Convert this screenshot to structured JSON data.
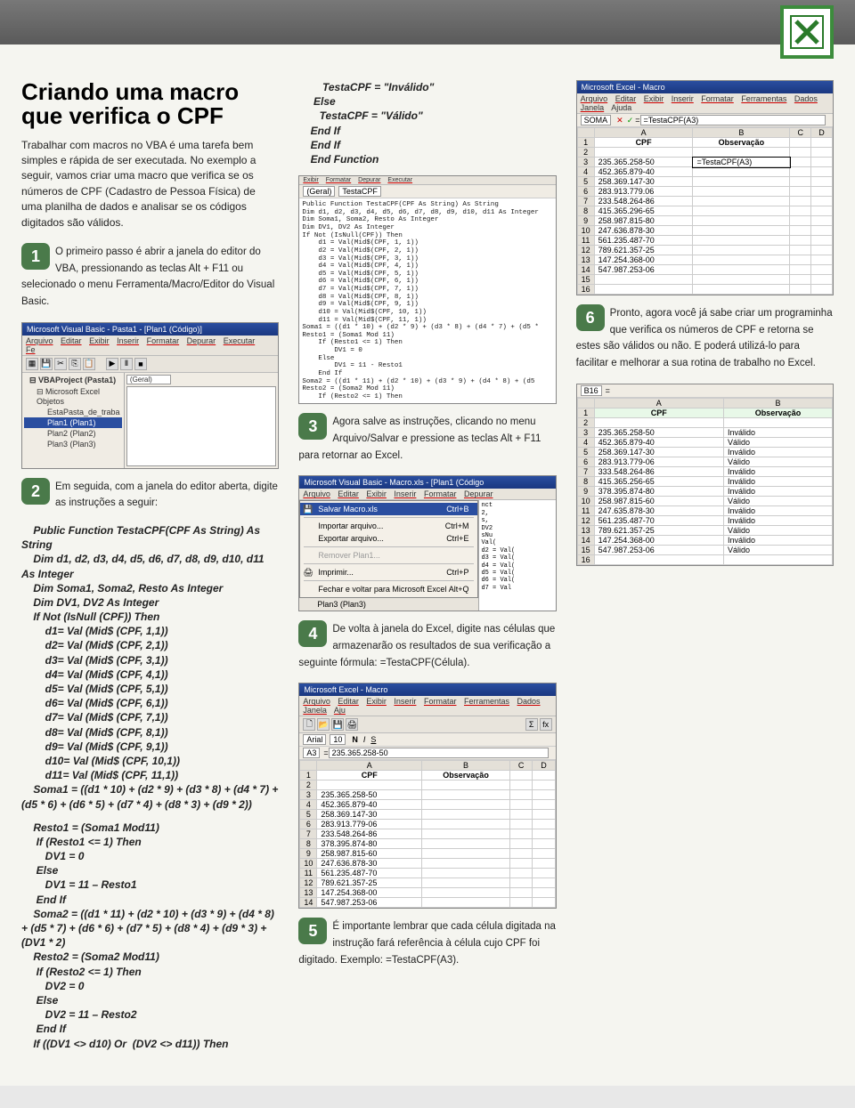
{
  "header": {
    "excelIconName": "excel-icon"
  },
  "article": {
    "title": "Criando uma macro que verifica o CPF",
    "intro": "Trabalhar com macros no VBA é uma tarefa bem simples e rápida de ser executada. No exemplo a seguir, vamos criar uma macro que verifica se os números de CPF (Cadastro de Pessoa Física) de uma planilha de dados e analisar se os códigos digitados são válidos."
  },
  "steps": {
    "s1": {
      "n": "1",
      "text": "O primeiro passo é abrir a janela do editor do VBA, pressionando as teclas Alt + F11 ou selecionado o menu Ferramenta/Macro/Editor do Visual Basic."
    },
    "s2": {
      "n": "2",
      "text": "Em seguida, com a janela do editor aberta, digite as instruções a seguir:"
    },
    "s3": {
      "n": "3",
      "text": "Agora salve as instruções, clicando no menu Arquivo/Salvar e pressione as teclas Alt + F11 para retornar ao Excel."
    },
    "s4": {
      "n": "4",
      "text": "De volta à janela do Excel, digite nas células que armazenarão os resultados de sua verificação a seguinte fórmula: =TestaCPF(Célula)."
    },
    "s5": {
      "n": "5",
      "text": "É importante lembrar que cada célula digitada na instrução fará referência à célula cujo CPF foi digitado. Exemplo: =TestaCPF(A3)."
    },
    "s6": {
      "n": "6",
      "text": "Pronto, agora você já sabe criar um programinha que verifica os números de CPF e retorna se estes são válidos ou não. E poderá utilizá-lo para facilitar e melhorar a sua rotina de trabalho no Excel."
    }
  },
  "code1": "    Public Function TestaCPF(CPF As String) As String\n    Dim d1, d2, d3, d4, d5, d6, d7, d8, d9, d10, d11 As Integer\n    Dim Soma1, Soma2, Resto As Integer\n    Dim DV1, DV2 As Integer\n    If Not (IsNull (CPF)) Then\n        d1= Val (Mid$ (CPF, 1,1))\n        d2= Val (Mid$ (CPF, 2,1))\n        d3= Val (Mid$ (CPF, 3,1))\n        d4= Val (Mid$ (CPF, 4,1))\n        d5= Val (Mid$ (CPF, 5,1))\n        d6= Val (Mid$ (CPF, 6,1))\n        d7= Val (Mid$ (CPF, 7,1))\n        d8= Val (Mid$ (CPF, 8,1))\n        d9= Val (Mid$ (CPF, 9,1))\n        d10= Val (Mid$ (CPF, 10,1))\n        d11= Val (Mid$ (CPF, 11,1))\n    Soma1 = ((d1 * 10) + (d2 * 9) + (d3 * 8) + (d4 * 7) + (d5 * 6) + (d6 * 5) + (d7 * 4) + (d8 * 3) + (d9 * 2))",
  "code2": "    Resto1 = (Soma1 Mod11)\n     If (Resto1 <= 1) Then\n        DV1 = 0\n     Else\n        DV1 = 11 – Resto1\n     End If\n    Soma2 = ((d1 * 11) + (d2 * 10) + (d3 * 9) + (d4 * 8) + (d5 * 7) + (d6 * 6) + (d7 * 5) + (d8 * 4) + (d9 * 3) + (DV1 * 2)\n    Resto2 = (Soma2 Mod11)\n     If (Resto2 <= 1) Then\n        DV2 = 0\n     Else\n        DV2 = 11 – Resto2\n     End If\n    If ((DV1 <> d10) Or  (DV2 <> d11)) Then\n        TestaCPF = \"Inválido\"\n     Else\n       TestaCPF = \"Válido\"\n    End If\n    End If\n    End Function",
  "shot_vbe1": {
    "title": "Microsoft Visual Basic - Pasta1 - [Plan1 (Código)]",
    "menus": [
      "Arquivo",
      "Editar",
      "Exibir",
      "Inserir",
      "Formatar",
      "Depurar",
      "Executar",
      "Fe"
    ],
    "dropdown": "(Geral)",
    "tree": {
      "root": "VBAProject (Pasta1)",
      "sub": "Microsoft Excel Objetos",
      "items": [
        "EstaPasta_de_traba",
        "Plan1 (Plan1)",
        "Plan2 (Plan2)",
        "Plan3 (Plan3)"
      ]
    }
  },
  "shot_vbe2": {
    "title": "Microsoft Visual Basic - Macro.xls - [Plan1 (Código)]",
    "code_drop": "TestaCPF",
    "code": "Public Function TestaCPF(CPF As String) As String\nDim d1, d2, d3, d4, d5, d6, d7, d8, d9, d10, d11 As Integer\nDim Soma1, Soma2, Resto As Integer\nDim DV1, DV2 As Integer\nIf Not (IsNull(CPF)) Then\n    d1 = Val(Mid$(CPF, 1, 1))\n    d2 = Val(Mid$(CPF, 2, 1))\n    d3 = Val(Mid$(CPF, 3, 1))\n    d4 = Val(Mid$(CPF, 4, 1))\n    d5 = Val(Mid$(CPF, 5, 1))\n    d6 = Val(Mid$(CPF, 6, 1))\n    d7 = Val(Mid$(CPF, 7, 1))\n    d8 = Val(Mid$(CPF, 8, 1))\n    d9 = Val(Mid$(CPF, 9, 1))\n    d10 = Val(Mid$(CPF, 10, 1))\n    d11 = Val(Mid$(CPF, 11, 1))\nSoma1 = ((d1 * 10) + (d2 * 9) + (d3 * 8) + (d4 * 7) + (d5 *\nResto1 = (Soma1 Mod 11)\n    If (Resto1 <= 1) Then\n        DV1 = 0\n    Else\n        DV1 = 11 - Resto1\n    End If\nSoma2 = ((d1 * 11) + (d2 * 10) + (d3 * 9) + (d4 * 8) + (d5\nResto2 = (Soma2 Mod 11)\n    If (Resto2 <= 1) Then"
  },
  "shot_menu": {
    "title": "Microsoft Visual Basic - Macro.xls - [Plan1 (Código",
    "menus": [
      "Arquivo",
      "Editar",
      "Exibir",
      "Inserir",
      "Formatar",
      "Depurar"
    ],
    "items": [
      {
        "label": "Salvar Macro.xls",
        "shortcut": "Ctrl+B",
        "sel": true
      },
      {
        "sep": true
      },
      {
        "label": "Importar arquivo...",
        "shortcut": "Ctrl+M"
      },
      {
        "label": "Exportar arquivo...",
        "shortcut": "Ctrl+E"
      },
      {
        "sep": true
      },
      {
        "label": "Remover Plan1...",
        "shortcut": "",
        "dis": true
      },
      {
        "sep": true
      },
      {
        "label": "Imprimir...",
        "shortcut": "Ctrl+P"
      },
      {
        "sep": true
      },
      {
        "label": "Fechar e voltar para Microsoft Excel",
        "shortcut": "Alt+Q"
      }
    ],
    "peek_tree": "Plan3 (Plan3)",
    "peek_code": [
      "nct",
      "2,",
      "s,",
      "DV2",
      "sNu",
      "Val(",
      "d2 = Val(",
      "d3 = Val(",
      "d4 = Val(",
      "d5 = Val(",
      "d6 = Val(",
      "d7 = Val"
    ]
  },
  "shot_excel": {
    "title": "Microsoft Excel - Macro",
    "menus": [
      "Arquivo",
      "Editar",
      "Exibir",
      "Inserir",
      "Formatar",
      "Ferramentas",
      "Dados",
      "Janela",
      "Aju"
    ],
    "font": "Arial",
    "size": "10",
    "name_box1": "A3",
    "formula1": "235.365.258-50",
    "name_box2": "SOMA",
    "formula2": "=TestaCPF(A3)",
    "name_box3": "B16",
    "header_a": "CPF",
    "header_b": "Observação",
    "rows": [
      {
        "a": "235.365.258-50"
      },
      {
        "a": "452.365.879-40"
      },
      {
        "a": "258.369.147-30"
      },
      {
        "a": "283.913.779-06"
      },
      {
        "a": "233.548.264-86"
      },
      {
        "a": "378.395.874-80"
      },
      {
        "a": "258.987.815-60"
      },
      {
        "a": "247.636.878-30"
      },
      {
        "a": "561.235.487-70"
      },
      {
        "a": "789.621.357-25"
      },
      {
        "a": "147.254.368-00"
      },
      {
        "a": "547.987.253-06"
      }
    ],
    "rows2": [
      {
        "a": "235.365.258-50",
        "b": "=TestaCPF(A3)"
      },
      {
        "a": "452.365.879-40"
      },
      {
        "a": "258.369.147-30"
      },
      {
        "a": "283.913.779.06"
      },
      {
        "a": "233.548.264-86"
      },
      {
        "a": "415.365.296-65"
      },
      {
        "a": "258.987.815-80"
      },
      {
        "a": "247.636.878-30"
      },
      {
        "a": "561.235.487-70"
      },
      {
        "a": "789.621.357-25"
      },
      {
        "a": "147.254.368-00"
      },
      {
        "a": "547.987.253-06"
      }
    ],
    "rows3": [
      {
        "a": "235.365.258-50",
        "b": "Inválido"
      },
      {
        "a": "452.365.879-40",
        "b": "Válido"
      },
      {
        "a": "258.369.147-30",
        "b": "Inválido"
      },
      {
        "a": "283.913.779-06",
        "b": "Válido"
      },
      {
        "a": "333.548.264-86",
        "b": "Inválido"
      },
      {
        "a": "415.365.256-65",
        "b": "Inválido"
      },
      {
        "a": "378.395.874-80",
        "b": "Inválido"
      },
      {
        "a": "258.987.815-60",
        "b": "Válido"
      },
      {
        "a": "247.635.878-30",
        "b": "Inválido"
      },
      {
        "a": "561.235.487-70",
        "b": "Inválido"
      },
      {
        "a": "789.621.357-25",
        "b": "Válido"
      },
      {
        "a": "147.254.368-00",
        "b": "Inválido"
      },
      {
        "a": "547.987.253-06",
        "b": "Válido"
      }
    ]
  }
}
